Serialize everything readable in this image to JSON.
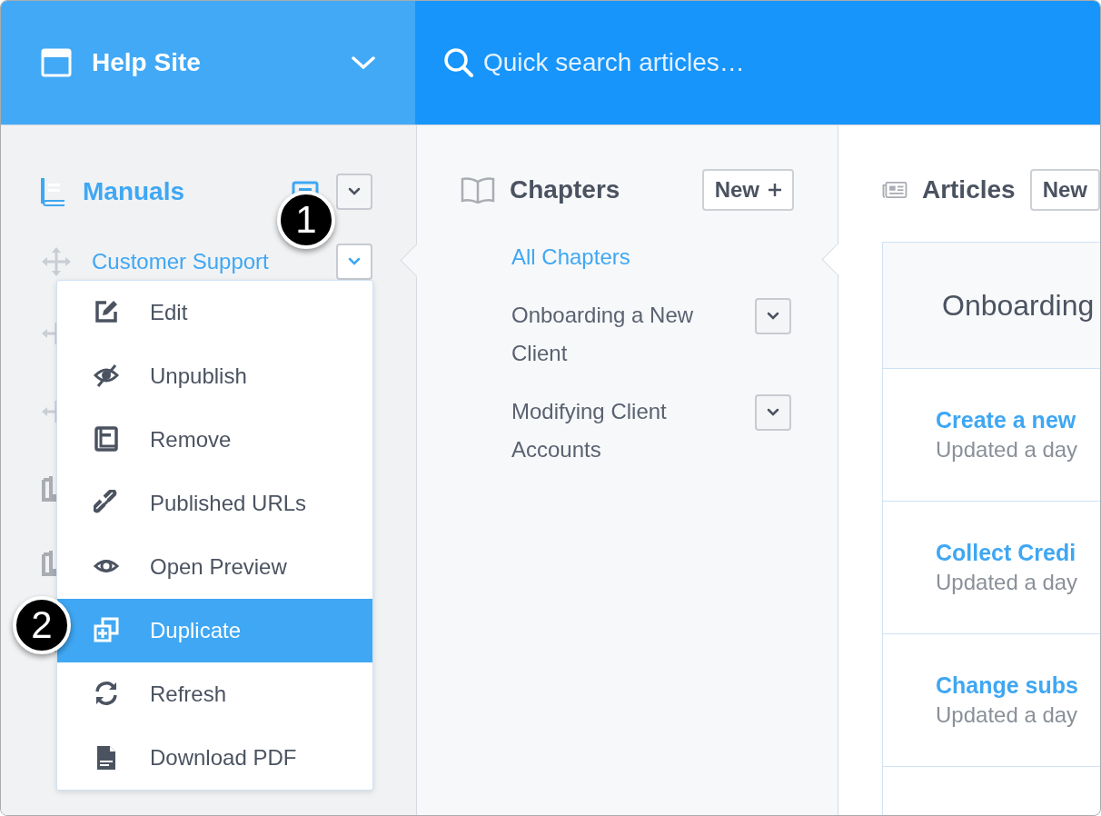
{
  "site": {
    "title": "Help Site"
  },
  "search": {
    "placeholder": "Quick search articles…"
  },
  "sidebar": {
    "heading": "Manuals",
    "items": [
      {
        "label": "Customer Support",
        "selected": true
      }
    ]
  },
  "menu": {
    "items": [
      {
        "label": "Edit",
        "selected": false
      },
      {
        "label": "Unpublish",
        "selected": false
      },
      {
        "label": "Remove",
        "selected": false
      },
      {
        "label": "Published URLs",
        "selected": false
      },
      {
        "label": "Open Preview",
        "selected": false
      },
      {
        "label": "Duplicate",
        "selected": true
      },
      {
        "label": "Refresh",
        "selected": false
      },
      {
        "label": "Download PDF",
        "selected": false
      }
    ]
  },
  "chapters": {
    "title": "Chapters",
    "new_button": "New",
    "items": [
      {
        "label": "All Chapters",
        "selected": true,
        "has_menu": false
      },
      {
        "label": "Onboarding a New Client",
        "selected": false,
        "has_menu": true
      },
      {
        "label": "Modifying Client Accounts",
        "selected": false,
        "has_menu": true
      }
    ]
  },
  "articles": {
    "title": "Articles",
    "new_button": "New",
    "group": "Onboarding",
    "items": [
      {
        "title": "Create a new",
        "meta": "Updated a day"
      },
      {
        "title": "Collect Credi",
        "meta": "Updated a day"
      },
      {
        "title": "Change subs",
        "meta": "Updated a day"
      }
    ]
  },
  "callouts": [
    "1",
    "2"
  ]
}
